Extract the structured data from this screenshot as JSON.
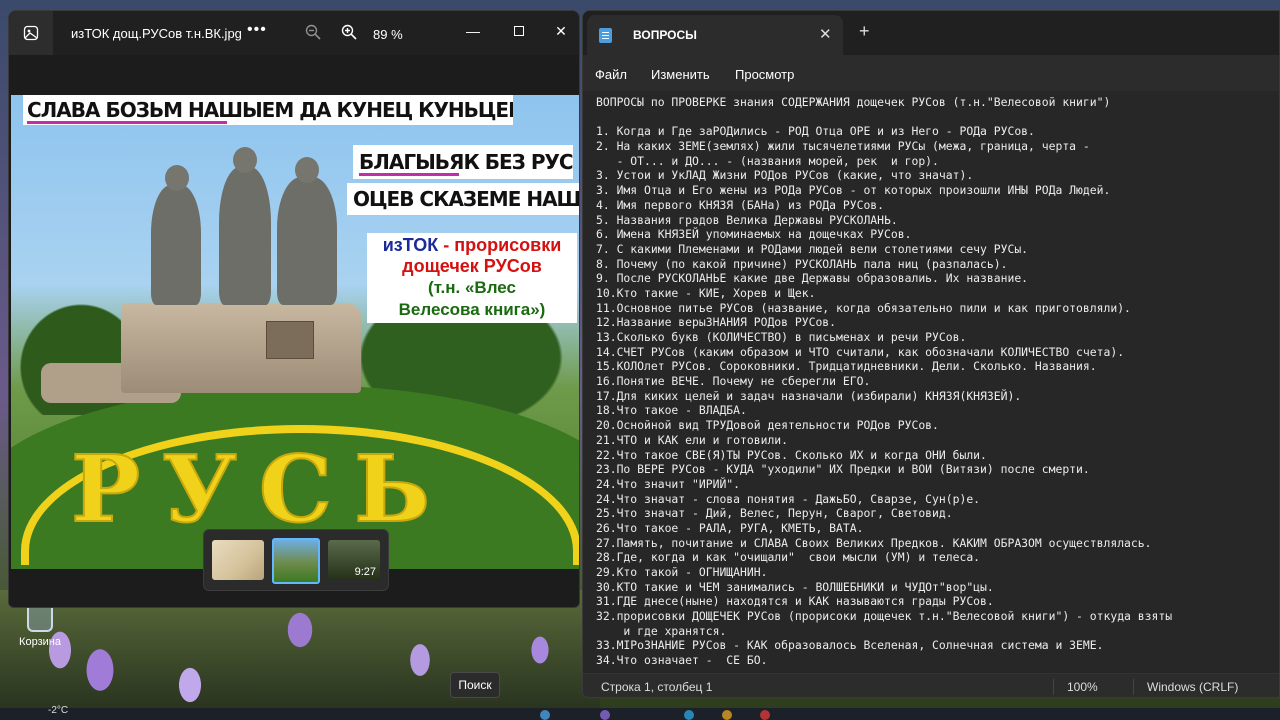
{
  "desktop": {
    "recycle_label": "Корзина",
    "search_tooltip": "Поиск",
    "weather_temp": "-2°C"
  },
  "photos": {
    "filename": "изТОК дощ.РУСов т.н.ВК.jpg",
    "more_label": "•••",
    "zoom": "89 %",
    "image": {
      "banner1": "СЛАВА БОЗЬМ НАШЫЕМ ДА КУНЕЦ КУНЬЦЕВЬ КОЛЕЗЕМЕ",
      "banner2": "БЛАГЫЬЯК БЕЗ РУСЕ",
      "banner3": "ОЦЕВ СКАЗЕМЕ НАШЫЕ",
      "title_a": "изТОК",
      "title_dash": " - ",
      "title_b": "прорисовки",
      "title_l2": "дощечек  РУСов",
      "title_l3": "(т.н.  «Влес",
      "title_l4": "Велесова  книга»)",
      "flower_word": "РУСЬ"
    },
    "video_duration": "9:27"
  },
  "notepad": {
    "tab_title": "ВОПРОСЫ",
    "menu": [
      "Файл",
      "Изменить",
      "Просмотр"
    ],
    "lines": [
      "ВОПРОСЫ по ПРОВЕРКЕ знания СОДЕРЖАНИЯ дощечек РУСов (т.н.\"Велесовой книги\")",
      "",
      "1. Когда и Где заРОДились - РОД Отца ОРЕ и из Него - РОДа РУСов.",
      "2. На каких ЗЕМЕ(землях) жили тысячелетиями РУСы (межа, граница, черта -",
      "   - ОТ... и ДО... - (названия морей, рек  и гор).",
      "3. Устои и УкЛАД Жизни РОДов РУСов (какие, что значат).",
      "3. Имя Отца и Его жены из РОДа РУСов - от которых произошли ИНЫ РОДа Людей.",
      "4. Имя первого КНЯЗЯ (БАНа) из РОДа РУСов.",
      "5. Названия градов Велика Державы РУСКОЛАНЬ.",
      "6. Имена КНЯЗЕЙ упоминаемых на дощечках РУСов.",
      "7. С какими Племенами и РОДами людей вели столетиями сечу РУСы.",
      "8. Почему (по какой причине) РУСКОЛАНЬ пала ниц (разпалась).",
      "9. После РУСКОЛАНЬЕ какие две Державы образовалиь. Их название.",
      "10.Кто такие - КИЕ, Хорев и Щек.",
      "11.Основное питье РУСов (название, когда обязательно пили и как приготовляли).",
      "12.Название верыЗНАНИЯ РОДов РУСов.",
      "13.Сколько букв (КОЛИЧЕСТВО) в письменах и речи РУСов.",
      "14.СЧЕТ РУСов (каким образом и ЧТО считали, как обозначали КОЛИЧЕСТВО счета).",
      "15.КОЛОлет РУСов. Сороковники. Тридцатидневники. Дели. Сколько. Названия.",
      "16.Понятие ВЕЧЕ. Почему не сберегли ЕГО.",
      "17.Для киких целей и задач назначали (избирали) КНЯЗЯ(КНЯЗЕЙ).",
      "18.Что такое - ВЛАДБА.",
      "20.Оснойной вид ТРУДовой деятельности РОДов РУСов.",
      "21.ЧТО и КАК ели и готовили.",
      "22.Что такое СВЕ(Я)ТЫ РУСов. Сколько ИХ и когда ОНИ были.",
      "23.По ВЕРЕ РУСов - КУДА \"уходили\" ИХ Предки и ВОИ (Витязи) после смерти.",
      "24.Что значит \"ИРИЙ\".",
      "24.Что значат - слова понятия - ДажьБО, Сварзе, Сун(р)е.",
      "25.Что значат - Дий, Велес, Перун, Сварог, Световид.",
      "26.Что такое - РАЛА, РУГА, КМЕТЬ, ВАТА.",
      "27.Память, почитание и СЛАВА Своих Великих Предков. КАКИМ ОБРАЗОМ осуществлялась.",
      "28.Где, когда и как \"очищали\"  свои мысли (УМ) и телеса.",
      "29.Кто такой - ОГНИЩАНИН.",
      "30.КТО такие и ЧЕМ занимались - ВОЛШЕБНИКИ и ЧУДОт\"вор\"цы.",
      "31.ГДЕ днесе(ныне) находятся и КАК называются грады РУСов.",
      "32.прорисовки ДОЩЕЧЕК РУСов (прорисоки дощечек т.н.\"Велесовой книги\") - откуда взяты",
      "    и где хранятся.",
      "33.МIРоЗНАНИЕ РУСов - КАК образовалось Вселеная, Солнечная система и ЗЕМЕ.",
      "34.Что означает -  СЕ БО."
    ],
    "status": {
      "position": "Строка 1, столбец 1",
      "zoom": "100%",
      "line_endings": "Windows (CRLF)"
    }
  }
}
